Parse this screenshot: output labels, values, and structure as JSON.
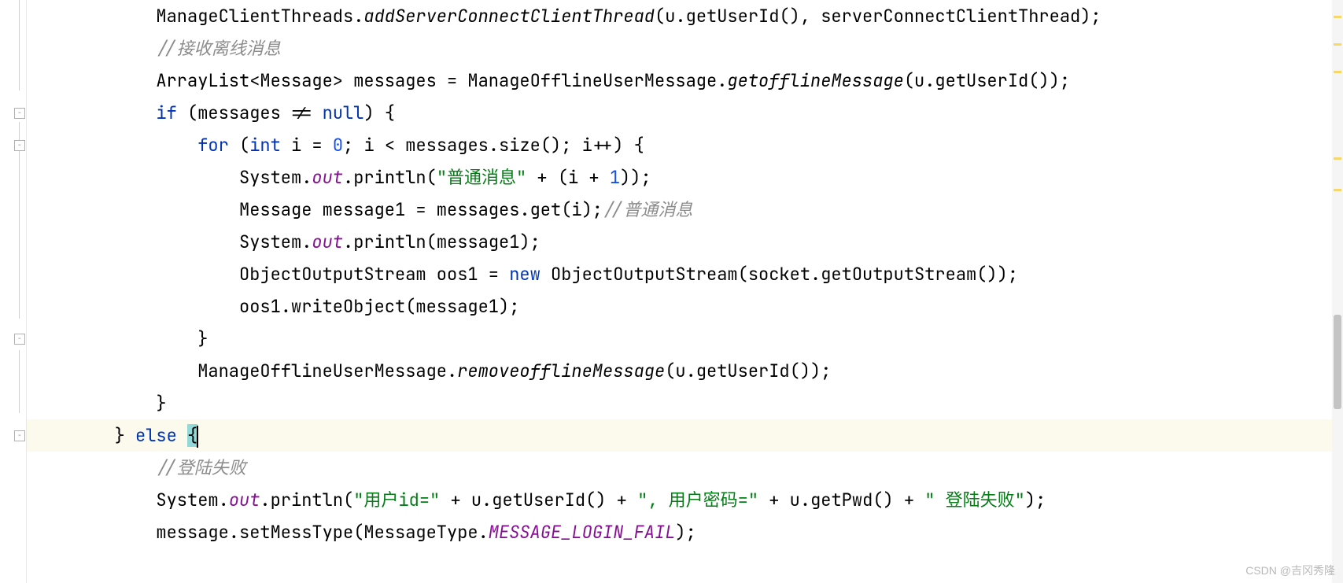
{
  "code": {
    "t1": "            ManageClientThreads.",
    "t2": "addServerConnectClientThread",
    "t3": "(u.getUserId(), serverConnectClientThread);",
    "t4": "            //接收离线消息",
    "t5": "            ArrayList<Message> messages = ManageOfflineUserMessage.",
    "t6": "getofflineMessage",
    "t7": "(u.getUserId());",
    "t8": "            ",
    "t8a": "if",
    "t8b": " (messages != ",
    "t8c": "null",
    "t8d": ") {",
    "t9a": "                ",
    "t9b": "for",
    "t9c": " (",
    "t9d": "int",
    "t9e": " i = ",
    "t9f": "0",
    "t9g": "; i < messages.size(); i++) {",
    "t10a": "                    System.",
    "t10b": "out",
    "t10c": ".println(",
    "t10d": "\"普通消息\"",
    "t10e": " + (i + ",
    "t10f": "1",
    "t10g": "));",
    "t11a": "                    Message message1 = messages.get(i);",
    "t11b": "//普通消息",
    "t12a": "                    System.",
    "t12b": "out",
    "t12c": ".println(message1);",
    "t13a": "                    ObjectOutputStream oos1 = ",
    "t13b": "new",
    "t13c": " ObjectOutputStream(socket.getOutputStream());",
    "t14": "                    oos1.writeObject(message1);",
    "t15": "                }",
    "t16a": "                ManageOfflineUserMessage.",
    "t16b": "removeofflineMessage",
    "t16c": "(u.getUserId());",
    "t17": "            }",
    "t18a": "        } ",
    "t18b": "else",
    "t18c": " ",
    "t18d": "{",
    "t19": "            //登陆失败",
    "t20a": "            System.",
    "t20b": "out",
    "t20c": ".println(",
    "t20d": "\"用户id=\"",
    "t20e": " + u.getUserId() + ",
    "t20f": "\", 用户密码=\"",
    "t20g": " + u.getPwd() + ",
    "t20h": "\" 登陆失败\"",
    "t20i": ");",
    "t21a": "            message.setMessType(MessageType.",
    "t21b": "MESSAGE_LOGIN_FAIL",
    "t21c": ");"
  },
  "watermark": "CSDN @吉冈秀隆"
}
